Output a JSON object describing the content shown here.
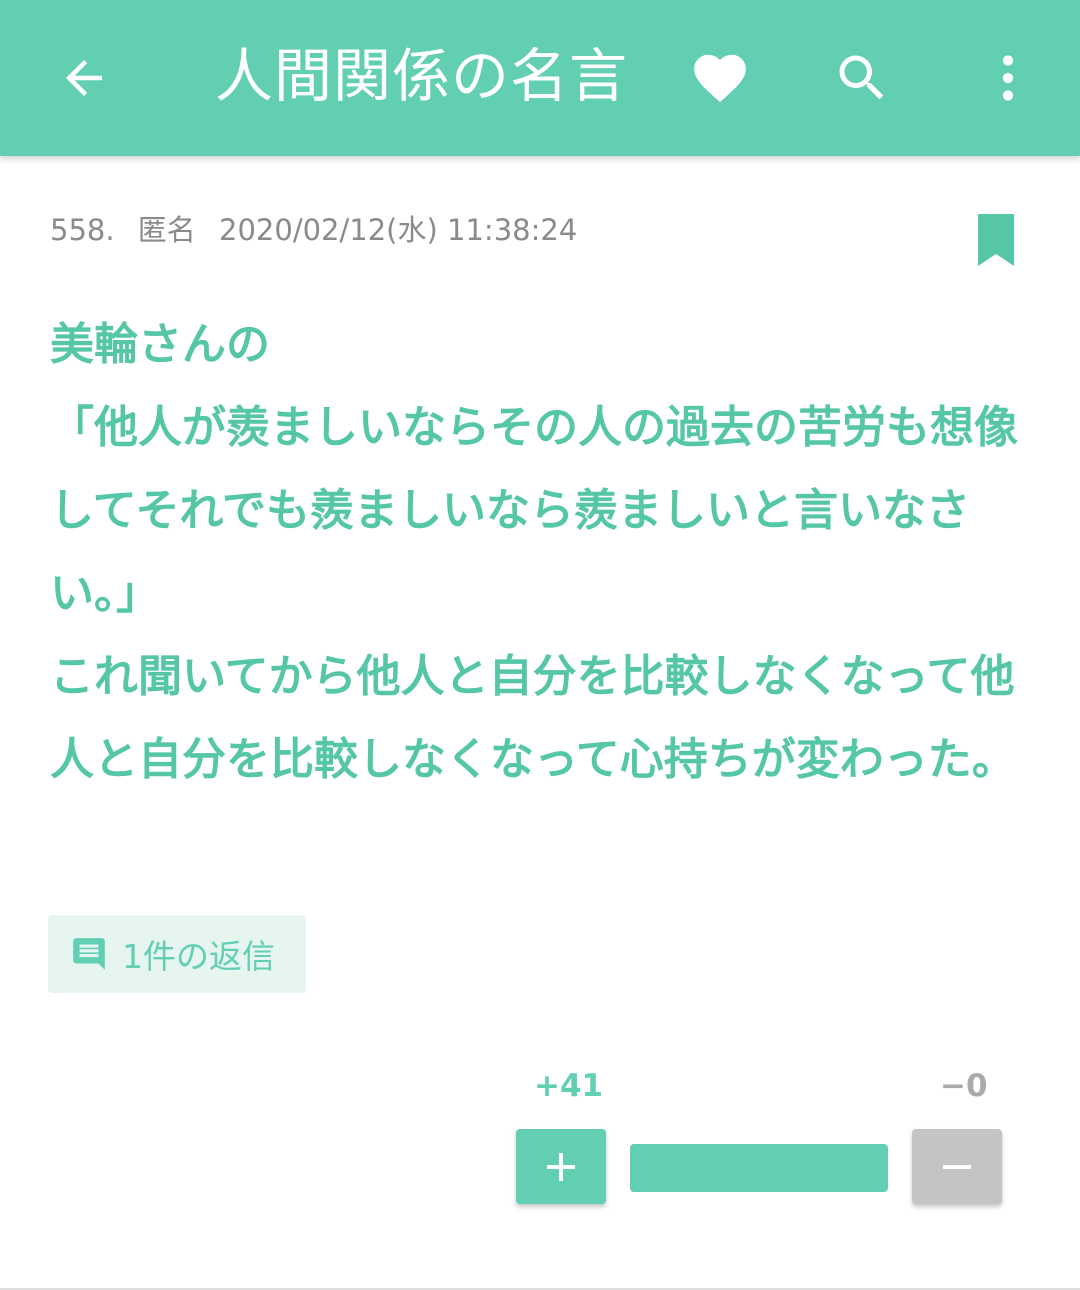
{
  "appbar": {
    "title": "人間関係の名言",
    "icons": [
      "arrow-left-icon",
      "heart-icon",
      "search-icon",
      "more-vert-icon"
    ],
    "color": "#62cfb3"
  },
  "post": {
    "number": "558.",
    "author": "匿名",
    "datetime": "2020/02/12(水) 11:38:24",
    "lines": [
      "美輪さんの",
      "「他人が羨ましいならその人の過去の苦労も想像してそれでも羨ましいなら羨ましいと言いなさい。」",
      "これ聞いてから他人と自分を比較しなくなって他人と自分を比較しなくなって心持ちが変わった。"
    ],
    "text_color": "#55c6a6"
  },
  "replies": {
    "label": "1件の返信"
  },
  "votes": {
    "plus": "+41",
    "minus": "−0",
    "plus_fraction": 1.0,
    "plus_color": "#62cfb3",
    "minus_color": "#c4c4c4"
  }
}
